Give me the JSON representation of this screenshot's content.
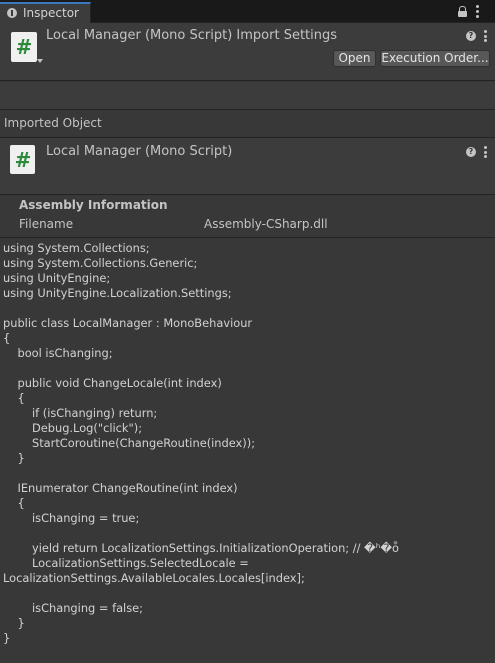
{
  "tab": {
    "label": "Inspector"
  },
  "header": {
    "title": "Local Manager (Mono Script) Import Settings",
    "open_label": "Open",
    "execution_order_label": "Execution Order..."
  },
  "imported_object": {
    "section_label": "Imported Object",
    "title": "Local Manager (Mono Script)"
  },
  "assembly": {
    "title": "Assembly Information",
    "filename_key": "Filename",
    "filename_value": "Assembly-CSharp.dll"
  },
  "code_lines": [
    "using System.Collections;",
    "using System.Collections.Generic;",
    "using UnityEngine;",
    "using UnityEngine.Localization.Settings;",
    "",
    "public class LocalManager : MonoBehaviour",
    "{",
    "    bool isChanging;",
    "",
    "    public void ChangeLocale(int index)",
    "    {",
    "        if (isChanging) return;",
    "        Debug.Log(\"click\");",
    "        StartCoroutine(ChangeRoutine(index));",
    "    }",
    "",
    "    IEnumerator ChangeRoutine(int index)",
    "    {",
    "        isChanging = true;",
    "",
    "        yield return LocalizationSettings.InitializationOperation; // �ʰ�ȭ",
    "        LocalizationSettings.SelectedLocale =",
    "LocalizationSettings.AvailableLocales.Locales[index];",
    "",
    "        isChanging = false;",
    "    }",
    "}"
  ]
}
